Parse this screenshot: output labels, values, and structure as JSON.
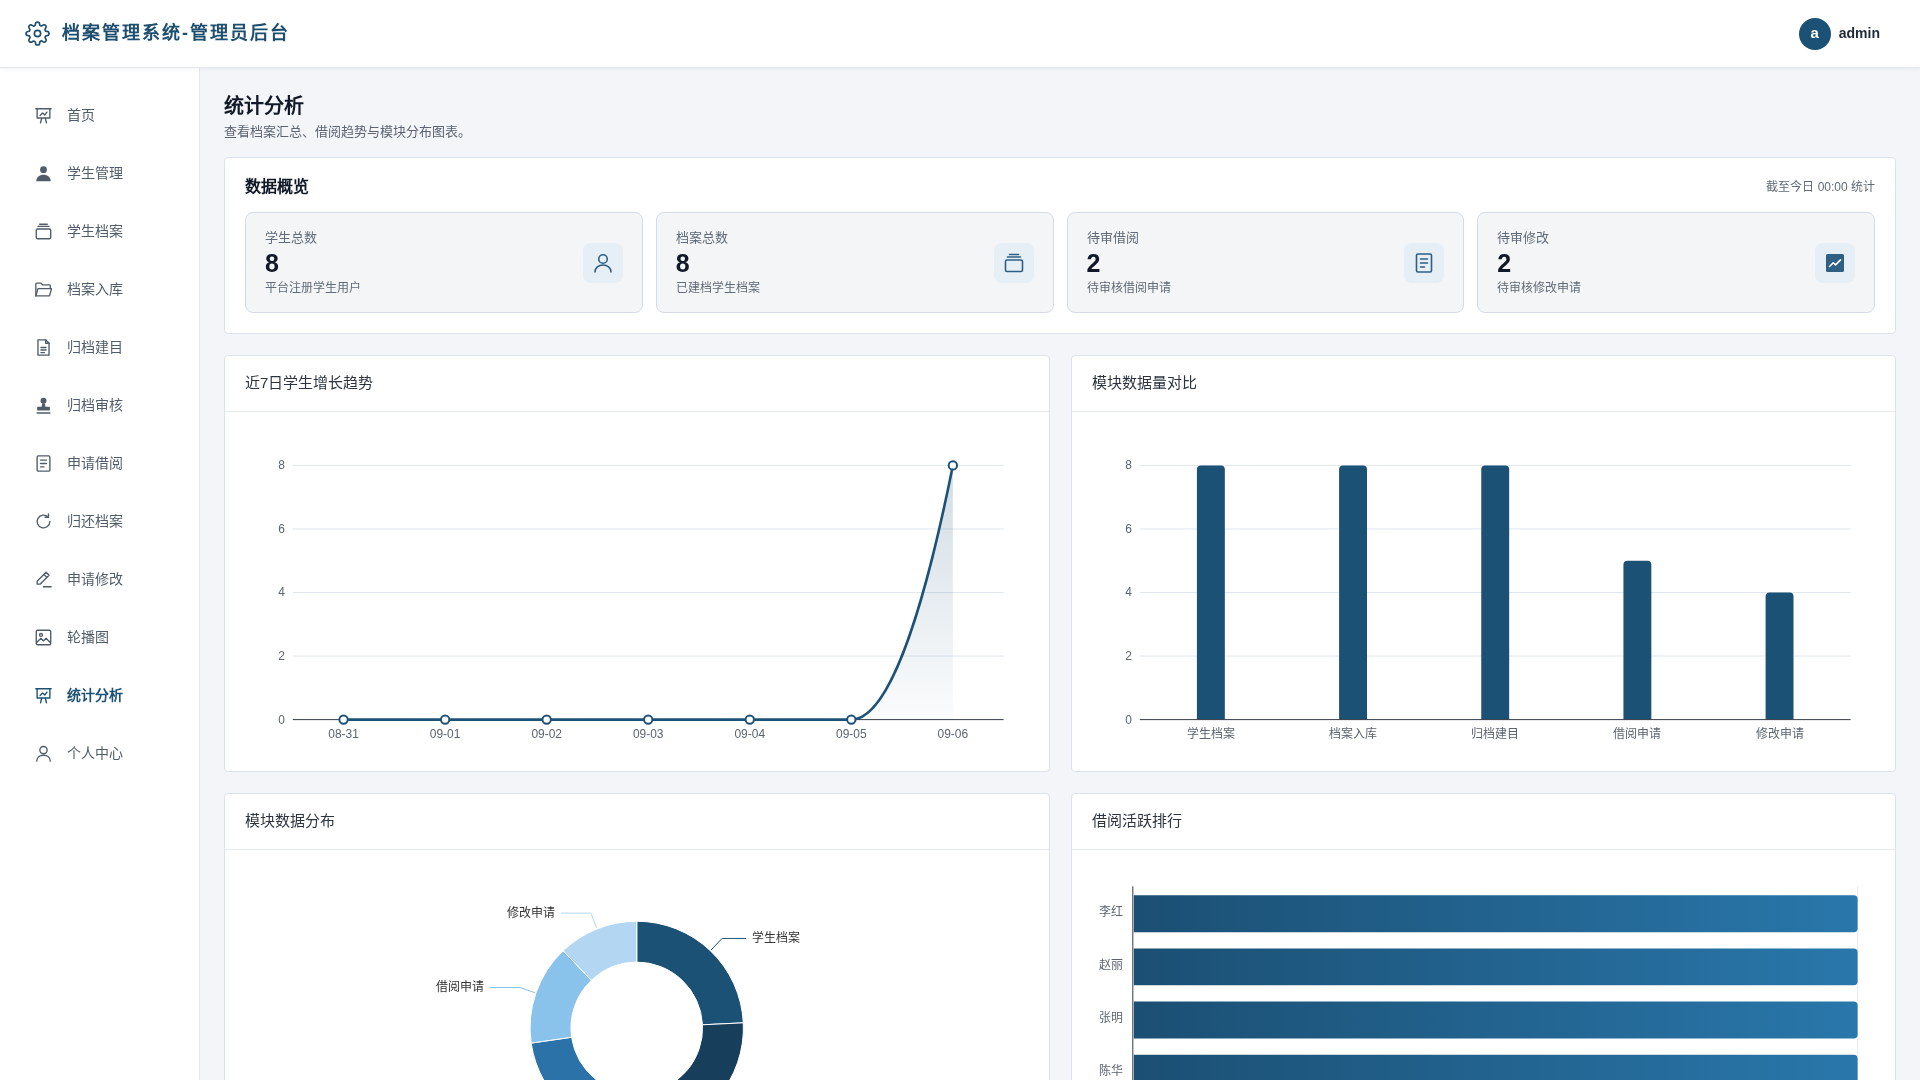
{
  "header": {
    "title": "档案管理系统-管理员后台",
    "user": {
      "avatar_letter": "a",
      "name": "admin"
    }
  },
  "sidebar": {
    "items": [
      {
        "label": "首页",
        "selected": false
      },
      {
        "label": "学生管理",
        "selected": false
      },
      {
        "label": "学生档案",
        "selected": false
      },
      {
        "label": "档案入库",
        "selected": false
      },
      {
        "label": "归档建目",
        "selected": false
      },
      {
        "label": "归档审核",
        "selected": false
      },
      {
        "label": "申请借阅",
        "selected": false
      },
      {
        "label": "归还档案",
        "selected": false
      },
      {
        "label": "申请修改",
        "selected": false
      },
      {
        "label": "轮播图",
        "selected": false
      },
      {
        "label": "统计分析",
        "selected": true
      },
      {
        "label": "个人中心",
        "selected": false
      }
    ]
  },
  "page": {
    "title": "统计分析",
    "subtitle": "查看档案汇总、借阅趋势与模块分布图表。"
  },
  "overview": {
    "title": "数据概览",
    "note": "截至今日 00:00 统计",
    "stats": [
      {
        "label": "学生总数",
        "value": "8",
        "caption": "平台注册学生用户"
      },
      {
        "label": "档案总数",
        "value": "8",
        "caption": "已建档学生档案"
      },
      {
        "label": "待审借阅",
        "value": "2",
        "caption": "待审核借阅申请"
      },
      {
        "label": "待审修改",
        "value": "2",
        "caption": "待审核修改申请"
      }
    ]
  },
  "growth_chart": {
    "title": "近7日学生增长趋势",
    "chart_data": {
      "type": "line",
      "categories": [
        "08-31",
        "09-01",
        "09-02",
        "09-03",
        "09-04",
        "09-05",
        "09-06"
      ],
      "values": [
        0,
        0,
        0,
        0,
        0,
        0,
        8
      ],
      "ylim": [
        0,
        8
      ],
      "yticks": [
        0,
        2,
        4,
        6,
        8
      ],
      "grid": true,
      "marker": true
    }
  },
  "module_chart": {
    "title": "模块数据量对比",
    "chart_data": {
      "type": "bar",
      "categories": [
        "学生档案",
        "档案入库",
        "归档建目",
        "借阅申请",
        "修改申请"
      ],
      "values": [
        8,
        8,
        8,
        5,
        4
      ],
      "ylim": [
        0,
        8
      ],
      "yticks": [
        0,
        2,
        4,
        6,
        8
      ],
      "grid": true
    }
  },
  "distribution": {
    "title": "模块数据分布",
    "slices": [
      {
        "label": "学生档案",
        "color": "#1b5174"
      },
      {
        "color": "#173f5c"
      },
      {
        "color": "#2a72a8"
      },
      {
        "label": "借阅申请",
        "color": "#89c2ea"
      },
      {
        "label": "修改申请",
        "color": "#b3d7f2"
      }
    ]
  },
  "ranking": {
    "title": "借阅活跃排行",
    "names": [
      "李红",
      "赵丽",
      "张明",
      "陈华"
    ]
  }
}
